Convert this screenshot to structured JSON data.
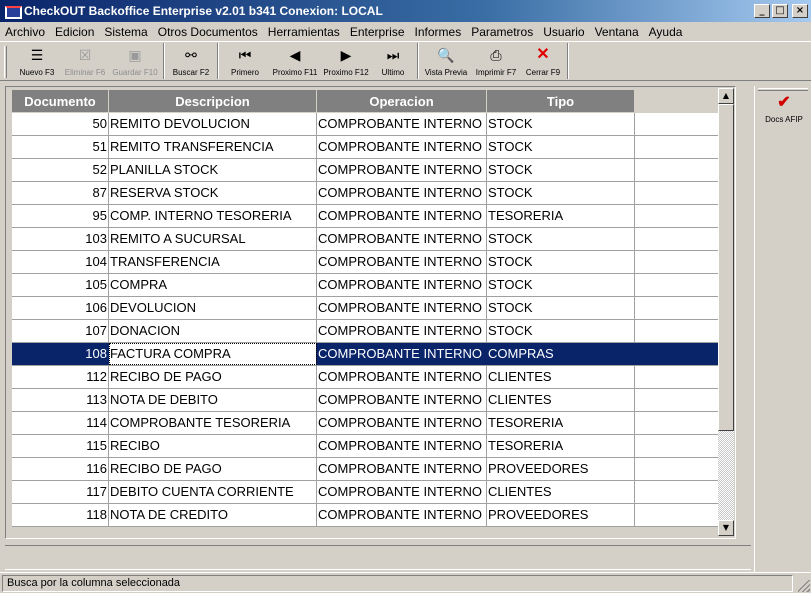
{
  "window": {
    "title": "CheckOUT Backoffice Enterprise v2.01 b341 Conexion: LOCAL",
    "min_glyph": "_",
    "max_glyph": "□",
    "close_glyph": "×"
  },
  "menu": [
    "Archivo",
    "Edicion",
    "Sistema",
    "Otros Documentos",
    "Herramientas",
    "Enterprise",
    "Informes",
    "Parametros",
    "Usuario",
    "Ventana",
    "Ayuda"
  ],
  "toolbar": {
    "nuevo": {
      "label": "Nuevo F3",
      "icon": "☰",
      "enabled": true
    },
    "eliminar": {
      "label": "Eliminar F6",
      "icon": "☒",
      "enabled": false
    },
    "guardar": {
      "label": "Guardar F10",
      "icon": "▣",
      "enabled": false
    },
    "buscar": {
      "label": "Buscar F2",
      "icon": "⚯",
      "enabled": true
    },
    "primero": {
      "label": "Primero",
      "icon": "⏮",
      "enabled": true
    },
    "anterior": {
      "label": "Proximo F11",
      "icon": "◀",
      "enabled": true
    },
    "proximo": {
      "label": "Proximo F12",
      "icon": "▶",
      "enabled": true
    },
    "ultimo": {
      "label": "Ultimo",
      "icon": "⏭",
      "enabled": true
    },
    "vista": {
      "label": "Vista Previa",
      "icon": "🔍",
      "enabled": true
    },
    "imprimir": {
      "label": "Imprimir F7",
      "icon": "⎙",
      "enabled": true
    },
    "cerrar": {
      "label": "Cerrar F9",
      "icon": "✕",
      "enabled": true
    }
  },
  "grid": {
    "columns": [
      "Documento",
      "Descripcion",
      "Operacion",
      "Tipo"
    ],
    "rows": [
      [
        "50",
        "REMITO DEVOLUCION",
        "COMPROBANTE INTERNO",
        "STOCK"
      ],
      [
        "51",
        "REMITO TRANSFERENCIA",
        "COMPROBANTE INTERNO",
        "STOCK"
      ],
      [
        "52",
        "PLANILLA STOCK",
        "COMPROBANTE INTERNO",
        "STOCK"
      ],
      [
        "87",
        "RESERVA STOCK",
        "COMPROBANTE INTERNO",
        "STOCK"
      ],
      [
        "95",
        "COMP. INTERNO TESORERIA",
        "COMPROBANTE INTERNO",
        "TESORERIA"
      ],
      [
        "103",
        "REMITO A SUCURSAL",
        "COMPROBANTE INTERNO",
        "STOCK"
      ],
      [
        "104",
        "TRANSFERENCIA",
        "COMPROBANTE INTERNO",
        "STOCK"
      ],
      [
        "105",
        "COMPRA",
        "COMPROBANTE INTERNO",
        "STOCK"
      ],
      [
        "106",
        "DEVOLUCION",
        "COMPROBANTE INTERNO",
        "STOCK"
      ],
      [
        "107",
        "DONACION",
        "COMPROBANTE INTERNO",
        "STOCK"
      ],
      [
        "108",
        "FACTURA COMPRA",
        "COMPROBANTE INTERNO",
        "COMPRAS"
      ],
      [
        "112",
        "RECIBO DE PAGO",
        "COMPROBANTE INTERNO",
        "CLIENTES"
      ],
      [
        "113",
        "NOTA DE DEBITO",
        "COMPROBANTE INTERNO",
        "CLIENTES"
      ],
      [
        "114",
        "COMPROBANTE TESORERIA",
        "COMPROBANTE INTERNO",
        "TESORERIA"
      ],
      [
        "115",
        "RECIBO",
        "COMPROBANTE INTERNO",
        "TESORERIA"
      ],
      [
        "116",
        "RECIBO DE PAGO",
        "COMPROBANTE INTERNO",
        "PROVEEDORES"
      ],
      [
        "117",
        "DEBITO CUENTA CORRIENTE",
        "COMPROBANTE INTERNO",
        "CLIENTES"
      ],
      [
        "118",
        "NOTA DE CREDITO",
        "COMPROBANTE INTERNO",
        "PROVEEDORES"
      ]
    ],
    "selected_row": 10
  },
  "side_panel": {
    "afip_label": "Docs AFIP",
    "afip_icon": "✔"
  },
  "scroll": {
    "up_glyph": "▲",
    "down_glyph": "▼"
  },
  "status": {
    "text": "Busca por la columna seleccionada"
  }
}
